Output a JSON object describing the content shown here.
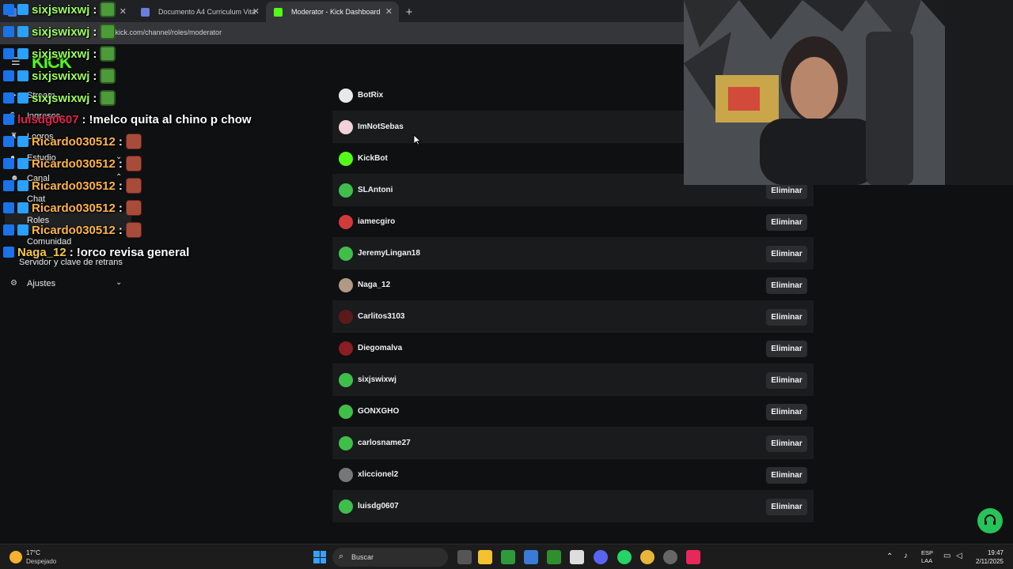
{
  "browser": {
    "tabs": [
      {
        "label": "",
        "active": false
      },
      {
        "label": "Documento A4 Curriculum Vita",
        "active": false
      },
      {
        "label": "Moderator - Kick Dashboard",
        "active": true
      }
    ],
    "url": "d.kick.com/channel/roles/moderator"
  },
  "sidebar": {
    "brand": "KICK",
    "items": [
      {
        "label": "Stream",
        "icon": "play-icon"
      },
      {
        "label": "Ingresos",
        "icon": "dollar-icon"
      },
      {
        "label": "Logros",
        "icon": "trophy-icon"
      },
      {
        "label": "Estudio",
        "icon": "mic-icon"
      },
      {
        "label": "Canal",
        "icon": "users-icon"
      }
    ],
    "canal_sub": [
      "Chat",
      "Roles",
      "Comunidad",
      "Servidor y clave de retrans"
    ],
    "settings_label": "Ajustes"
  },
  "chat_overlay": [
    {
      "name": "sixjswixwj",
      "sep": ":",
      "msg": "",
      "color": "green",
      "emote": "pepe"
    },
    {
      "name": "sixjswixwj",
      "sep": ":",
      "msg": "",
      "color": "green",
      "emote": "pepe"
    },
    {
      "name": "sixjswixwj",
      "sep": ":",
      "msg": "",
      "color": "green",
      "emote": "pepe"
    },
    {
      "name": "sixjswixwj",
      "sep": ":",
      "msg": "",
      "color": "green",
      "emote": "pepe"
    },
    {
      "name": "sixjswixwj",
      "sep": ":",
      "msg": "",
      "color": "green",
      "emote": "pepe"
    },
    {
      "name": "luisdg0607",
      "sep": ":",
      "msg": "!melco quita al chino p chow",
      "color": "red",
      "emote": ""
    },
    {
      "name": "Ricardo030512",
      "sep": ":",
      "msg": "",
      "color": "orange",
      "emote": "face"
    },
    {
      "name": "Ricardo030512",
      "sep": ":",
      "msg": "",
      "color": "orange",
      "emote": "face"
    },
    {
      "name": "Ricardo030512",
      "sep": ":",
      "msg": "",
      "color": "orange",
      "emote": "face"
    },
    {
      "name": "Ricardo030512",
      "sep": ":",
      "msg": "",
      "color": "orange",
      "emote": "face"
    },
    {
      "name": "Ricardo030512",
      "sep": ":",
      "msg": "",
      "color": "orange",
      "emote": "face"
    },
    {
      "name": "Naga_12",
      "sep": ":",
      "msg": "!orco revisa general",
      "color": "yellow",
      "emote": ""
    }
  ],
  "moderators": {
    "remove_label": "Eliminar",
    "rows": [
      {
        "name": "BotRix",
        "avatar_color": "#e8e8e8",
        "removable": false
      },
      {
        "name": "ImNotSebas",
        "avatar_color": "#f2d1d9",
        "removable": false
      },
      {
        "name": "KickBot",
        "avatar_color": "#53fc18",
        "removable": false
      },
      {
        "name": "SLAntoni",
        "avatar_color": "#3fbf4a",
        "removable": true
      },
      {
        "name": "iamecgiro",
        "avatar_color": "#d23a3a",
        "removable": true
      },
      {
        "name": "JeremyLingan18",
        "avatar_color": "#3fbf4a",
        "removable": true
      },
      {
        "name": "Naga_12",
        "avatar_color": "#b09a86",
        "removable": true
      },
      {
        "name": "Carlitos3103",
        "avatar_color": "#5a1a1a",
        "removable": true
      },
      {
        "name": "Diegomalva",
        "avatar_color": "#8a1e24",
        "removable": true
      },
      {
        "name": "sixjswixwj",
        "avatar_color": "#3fbf4a",
        "removable": true
      },
      {
        "name": "GONXGHO",
        "avatar_color": "#3fbf4a",
        "removable": true
      },
      {
        "name": "carlosname27",
        "avatar_color": "#3fbf4a",
        "removable": true
      },
      {
        "name": "xliccionel2",
        "avatar_color": "#777777",
        "removable": true
      },
      {
        "name": "luisdg0607",
        "avatar_color": "#3fbf4a",
        "removable": true
      }
    ]
  },
  "taskbar": {
    "weather_temp": "17°C",
    "weather_cond": "Despejado",
    "search_placeholder": "Buscar",
    "lang_top": "ESP",
    "lang_bottom": "LAA",
    "time": "19:47",
    "date": "2/11/2025"
  },
  "colors": {
    "accent": "#53fc18",
    "background": "#0f1011",
    "row_alt": "#191b1d",
    "button": "#2b2d30"
  }
}
